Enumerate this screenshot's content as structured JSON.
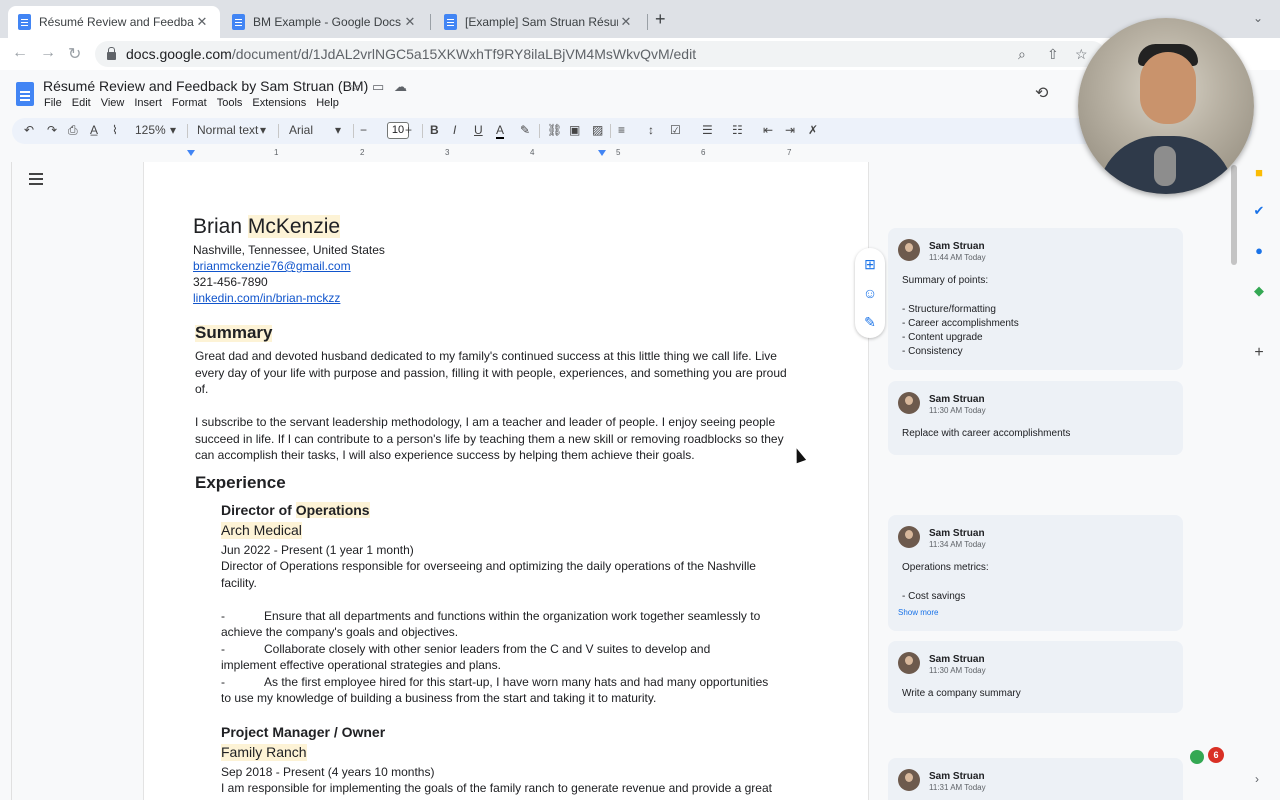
{
  "browser": {
    "tabs": [
      {
        "label": "Résumé Review and Feedback"
      },
      {
        "label": "BM Example - Google Docs"
      },
      {
        "label": "[Example] Sam Struan Résumé"
      }
    ],
    "url_host": "docs.google.com",
    "url_path": "/document/d/1JdAL2vrlNGC5a15XKWxhTf9RY8ilaLBjVM4MsWkvQvM/edit"
  },
  "docs": {
    "title": "Résumé Review and Feedback by Sam Struan (BM)",
    "menu": [
      "File",
      "Edit",
      "View",
      "Insert",
      "Format",
      "Tools",
      "Extensions",
      "Help"
    ],
    "toolbar": {
      "zoom": "125%",
      "style": "Normal text",
      "font": "Arial",
      "font_size": "10"
    },
    "ruler": [
      "1",
      "2",
      "3",
      "4",
      "5",
      "6",
      "7"
    ]
  },
  "document": {
    "name_first": "Brian ",
    "name_last": "McKenzie",
    "location": "Nashville, Tennessee, United States",
    "email": "brianmckenzie76@gmail.com",
    "phone": "321-456-7890",
    "linkedin": "linkedin.com/in/brian-mckzz",
    "summary_heading": "Summary",
    "summary_p1": "Great dad and devoted husband dedicated to my family's continued success at this little thing we call life. Live every day of your life with purpose and passion, filling it with people, experiences, and something you are proud of.",
    "summary_p2": "I subscribe to the servant leadership methodology, I am a teacher and leader of people. I enjoy seeing people succeed in life. If I can contribute to a person's life by teaching them a new skill or removing roadblocks so they can accomplish their tasks, I will also experience success by helping them achieve their goals.",
    "experience_heading": "Experience",
    "job1": {
      "title_a": "Director of ",
      "title_b": "Operations",
      "company": "Arch Medical",
      "dates": "Jun 2022 - Present (1 year 1 month)",
      "desc": "Director of Operations responsible for overseeing and optimizing the daily operations of the Nashville facility.",
      "bullets": [
        {
          "lead": "Ensure that all departments and functions within the organization work together seamlessly to",
          "rest": "achieve the company's goals and objectives."
        },
        {
          "lead": "Collaborate closely with other senior leaders from the C and V suites to develop and",
          "rest": "implement effective operational strategies and plans."
        },
        {
          "lead": "As the first employee hired for this start-up, I have worn many hats and had many opportunities",
          "rest": "to use my knowledge of building a business from the start and taking it to maturity."
        }
      ]
    },
    "job2": {
      "title": "Project Manager / Owner",
      "company": "Family Ranch",
      "dates": "Sep 2018 - Present (4 years 10 months)",
      "desc": "I am responsible for implementing the goals of the family ranch to generate revenue and provide a great"
    },
    "bullet_dash": "-"
  },
  "comments": [
    {
      "author": "Sam Struan",
      "time": "11:44 AM Today",
      "body": "Summary of points:\n\n- Structure/formatting\n- Career accomplishments\n- Content upgrade\n- Consistency"
    },
    {
      "author": "Sam Struan",
      "time": "11:30 AM Today",
      "body": "Replace with career accomplishments"
    },
    {
      "author": "Sam Struan",
      "time": "11:34 AM Today",
      "body": "Operations metrics:\n\n- Cost savings",
      "more": "Show more"
    },
    {
      "author": "Sam Struan",
      "time": "11:30 AM Today",
      "body": "Write a company summary"
    },
    {
      "author": "Sam Struan",
      "time": "11:31 AM Today",
      "body": ""
    }
  ],
  "badge_count": "6",
  "colors": {
    "accent": "#1a73e8",
    "docs_blue": "#4285f4",
    "highlight": "#fdf3d6",
    "link": "#1155cc"
  }
}
